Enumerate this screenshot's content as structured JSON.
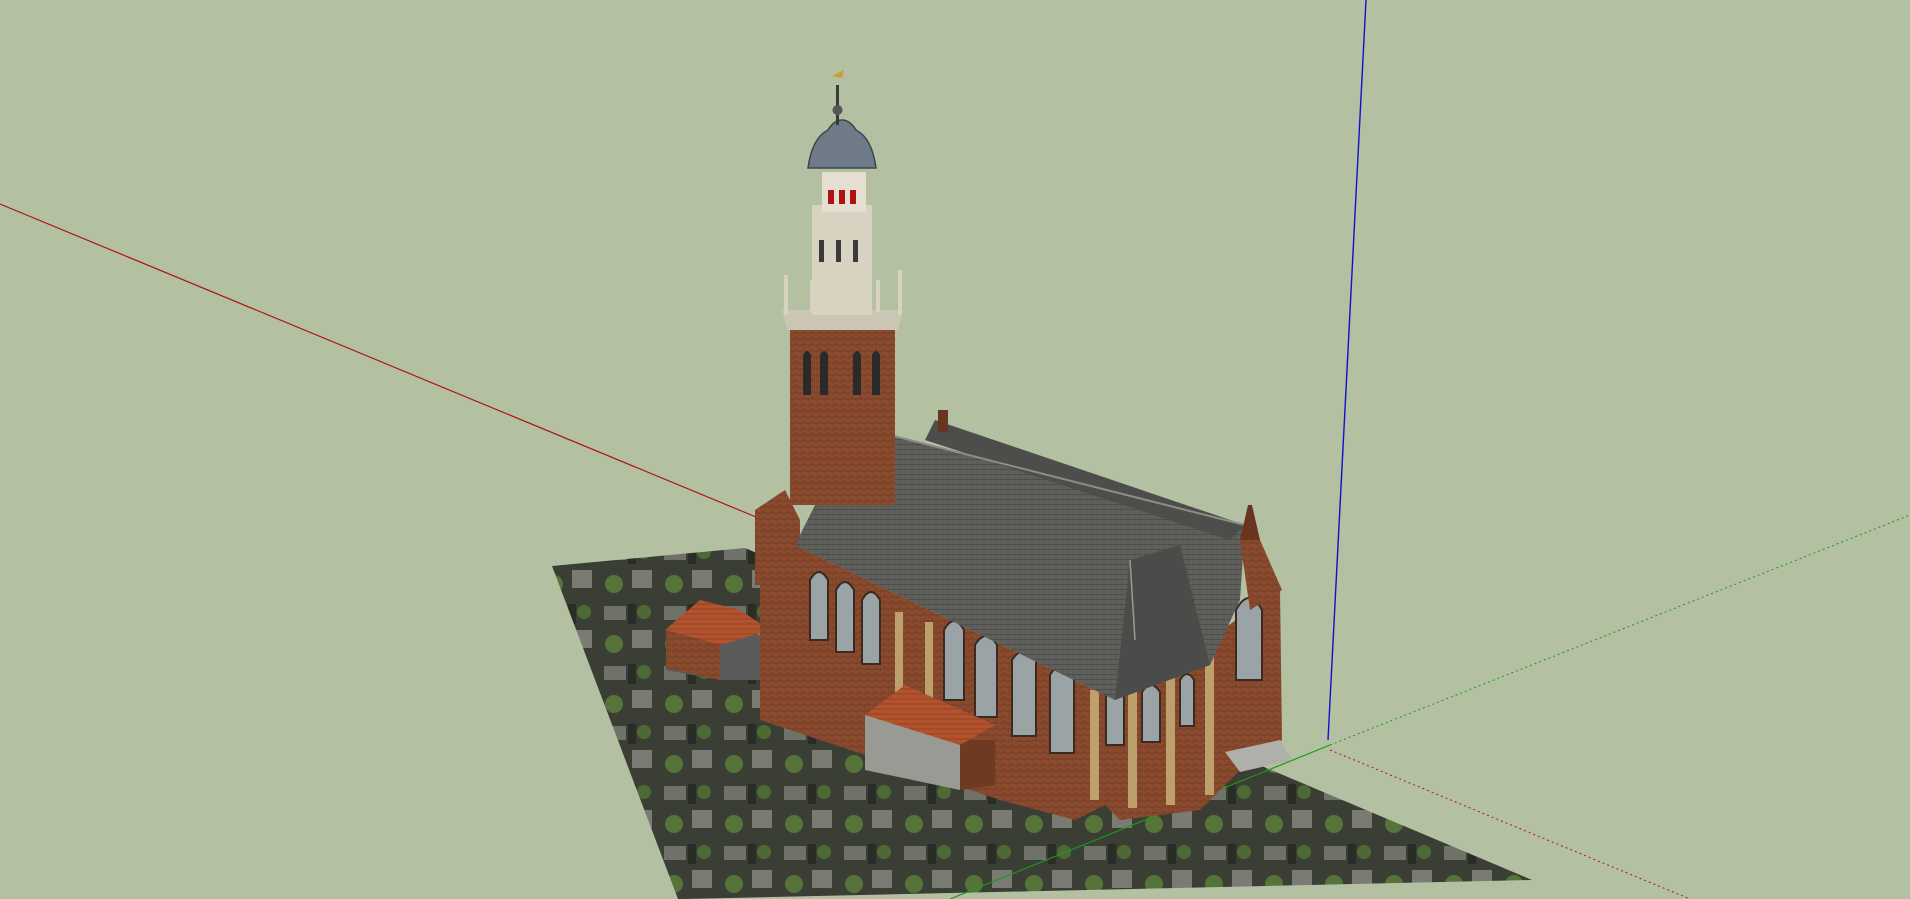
{
  "app": {
    "viewport_background": "#b4c0a2"
  },
  "axes": {
    "red": "#b01515",
    "green": "#1a9a1a",
    "blue": "#1010c8"
  },
  "model": {
    "subject": "church",
    "parts": [
      "bell-tower",
      "nave-roof",
      "choir-apse",
      "side-annex",
      "porch",
      "aerial-ground-image"
    ]
  },
  "colors": {
    "brick": "#8a4a2e",
    "brick_dark": "#6a3520",
    "roof": "#5a5a58",
    "roof_dark": "#454544",
    "stone": "#d8d2c0",
    "tile": "#b3532e",
    "ground_dark": "#34382e"
  }
}
